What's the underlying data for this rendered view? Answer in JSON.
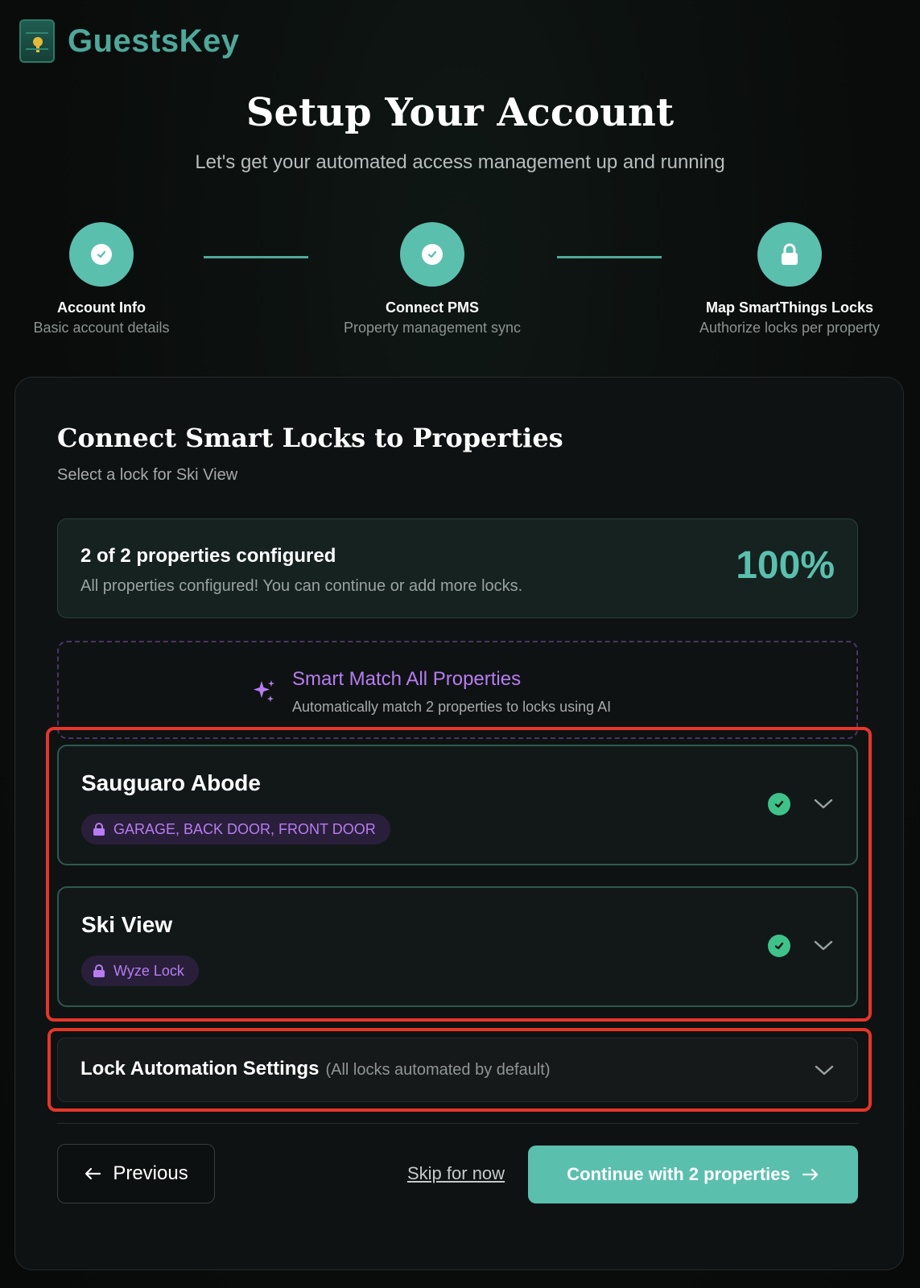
{
  "brand": {
    "name": "GuestsKey"
  },
  "header": {
    "title": "Setup Your Account",
    "subtitle": "Let's get your automated access management up and running"
  },
  "steps": [
    {
      "title": "Account Info",
      "subtitle": "Basic account details",
      "status": "complete",
      "icon": "check-icon"
    },
    {
      "title": "Connect PMS",
      "subtitle": "Property management sync",
      "status": "complete",
      "icon": "check-icon"
    },
    {
      "title": "Map SmartThings Locks",
      "subtitle": "Authorize locks per property",
      "status": "current",
      "icon": "lock-icon"
    }
  ],
  "card": {
    "title": "Connect Smart Locks to Properties",
    "subtitle": "Select a lock for Ski View"
  },
  "progress": {
    "title": "2 of 2 properties configured",
    "subtitle": "All properties configured! You can continue or add more locks.",
    "percent_label": "100%",
    "percent": 100
  },
  "smart_match": {
    "title": "Smart Match All Properties",
    "subtitle": "Automatically match 2 properties to locks using AI",
    "icon": "sparkle-icon"
  },
  "properties": [
    {
      "name": "Sauguaro Abode",
      "locks": "GARAGE, BACK DOOR, FRONT DOOR",
      "configured": true
    },
    {
      "name": "Ski View",
      "locks": "Wyze Lock",
      "configured": true
    }
  ],
  "automation": {
    "title": "Lock Automation Settings",
    "note": "(All locks automated by default)"
  },
  "footer": {
    "previous_label": "Previous",
    "skip_label": "Skip for now",
    "continue_label": "Continue with 2 properties"
  },
  "colors": {
    "accent": "#5bbfae",
    "purple": "#b77cf2",
    "success": "#3fc28a",
    "highlight": "#e5362a"
  }
}
